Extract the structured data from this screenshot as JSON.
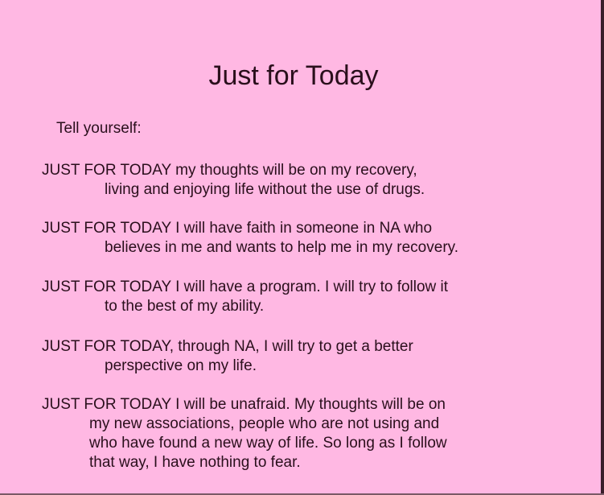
{
  "document": {
    "title": "Just for Today",
    "intro": "Tell yourself:",
    "paragraphs": [
      {
        "first_line": "JUST FOR TODAY my thoughts will be on my recovery,",
        "continuation": [
          "living and enjoying life without the use of drugs."
        ]
      },
      {
        "first_line": "JUST FOR TODAY I will have faith in someone in NA who",
        "continuation": [
          "believes in me and wants to help me in my recovery."
        ]
      },
      {
        "first_line": "JUST FOR TODAY I will have a program. I will try to follow it",
        "continuation": [
          "to the best of my ability."
        ]
      },
      {
        "first_line": "JUST FOR TODAY, through NA, I will try to get a better",
        "continuation": [
          "perspective on my life."
        ]
      },
      {
        "first_line": "JUST FOR TODAY I will be unafraid. My thoughts will be on",
        "continuation": [
          "my new associations, people who are not using and",
          "who have found a new way of life. So long as I follow",
          "that way, I have nothing to fear."
        ]
      }
    ]
  },
  "colors": {
    "background": "#ffb8e3",
    "text": "#2a0f1c",
    "border": "#3a1e2a"
  }
}
